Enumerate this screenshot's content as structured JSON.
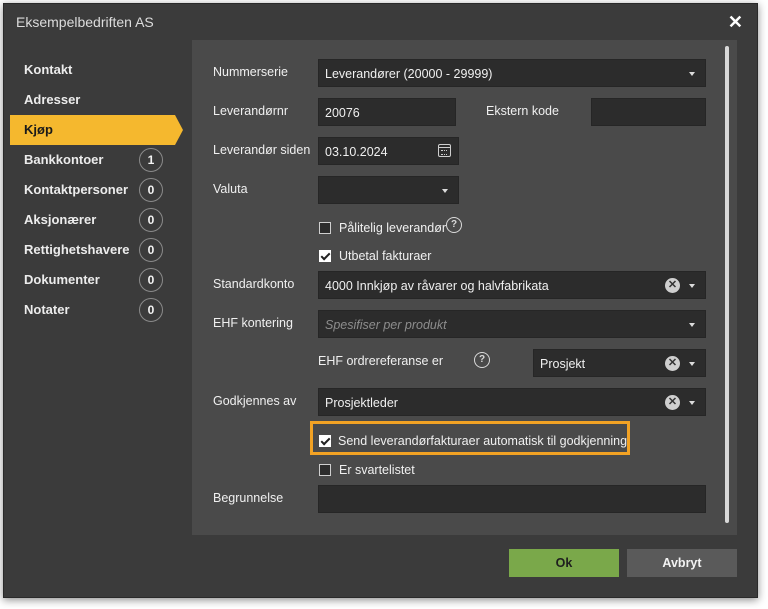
{
  "dialog": {
    "title": "Eksempelbedriften AS"
  },
  "nav": [
    {
      "label": "Kontakt",
      "badge": null
    },
    {
      "label": "Adresser",
      "badge": null
    },
    {
      "label": "Kjøp",
      "badge": null
    },
    {
      "label": "Bankkontoer",
      "badge": "1"
    },
    {
      "label": "Kontaktpersoner",
      "badge": "0"
    },
    {
      "label": "Aksjonærer",
      "badge": "0"
    },
    {
      "label": "Rettighetshavere",
      "badge": "0"
    },
    {
      "label": "Dokumenter",
      "badge": "0"
    },
    {
      "label": "Notater",
      "badge": "0"
    }
  ],
  "form": {
    "nummerserie": {
      "label": "Nummerserie",
      "value": "Leverandører (20000 - 29999)"
    },
    "leverandornr": {
      "label": "Leverandørnr",
      "value": "20076"
    },
    "ekstern_kode": {
      "label": "Ekstern kode",
      "value": ""
    },
    "leverandor_siden": {
      "label": "Leverandør siden",
      "value": "03.10.2024"
    },
    "valuta": {
      "label": "Valuta",
      "value": ""
    },
    "palitelig": {
      "label": "Pålitelig leverandør",
      "checked": false
    },
    "utbetal": {
      "label": "Utbetal fakturaer",
      "checked": true
    },
    "standardkonto": {
      "label": "Standardkonto",
      "value": "4000 Innkjøp av råvarer og halvfabrikata"
    },
    "ehf_kontering": {
      "label": "EHF kontering",
      "placeholder": "Spesifiser per produkt"
    },
    "ehf_ordrereferanse": {
      "label": "EHF ordrereferanse er",
      "value": "Prosjekt"
    },
    "godkjennes_av": {
      "label": "Godkjennes av",
      "value": "Prosjektleder"
    },
    "send_automatisk": {
      "label": "Send leverandørfakturaer automatisk til godkjenning",
      "checked": true
    },
    "svartelistet": {
      "label": "Er svartelistet",
      "checked": false
    },
    "begrunnelse": {
      "label": "Begrunnelse",
      "value": ""
    }
  },
  "buttons": {
    "ok": "Ok",
    "cancel": "Avbryt"
  },
  "colors": {
    "accent": "#f5b82e",
    "highlight": "#f2a224",
    "ok": "#7aa84a"
  },
  "icons": {
    "close": "close-icon",
    "help": "help-icon",
    "calendar": "calendar-icon",
    "clear": "clear-icon",
    "dropdown": "chevron-down-icon"
  }
}
